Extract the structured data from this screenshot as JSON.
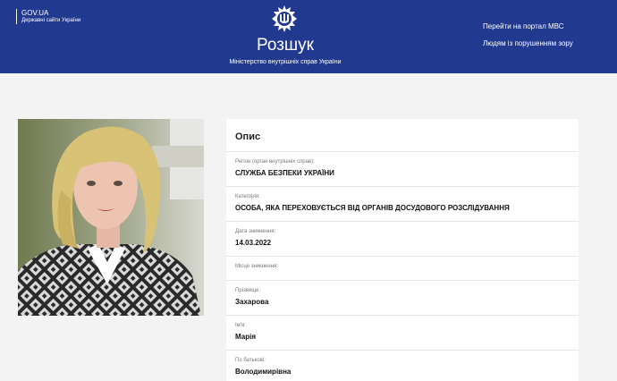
{
  "header": {
    "gov_title": "GOV.UA",
    "gov_subtitle": "Державні сайти України",
    "emblem_icon": "trident-emblem-icon",
    "title": "Розшук",
    "subtitle": "Міністерство внутрішніх справ України",
    "link_portal": "Перейти на портал МВС",
    "link_accessibility": "Людям із порушенням зору",
    "color": "#213a8f"
  },
  "photo": {
    "alt": "Фото"
  },
  "card": {
    "title": "Опис",
    "fields": [
      {
        "label": "Регіон (орган внутрішніх справ):",
        "value": "СЛУЖБА БЕЗПЕКИ УКРАЇНИ"
      },
      {
        "label": "Категорія:",
        "value": "ОСОБА, ЯКА ПЕРЕХОВУЄТЬСЯ ВІД ОРГАНІВ ДОСУДОВОГО РОЗСЛІДУВАННЯ"
      },
      {
        "label": "Дата зникнення:",
        "value": "14.03.2022"
      },
      {
        "label": "Місце зникнення:",
        "value": ""
      },
      {
        "label": "Прізвище:",
        "value": "Захарова"
      },
      {
        "label": "Ім'я:",
        "value": "Марія"
      },
      {
        "label": "По батькові:",
        "value": "Володимирівна"
      }
    ]
  }
}
